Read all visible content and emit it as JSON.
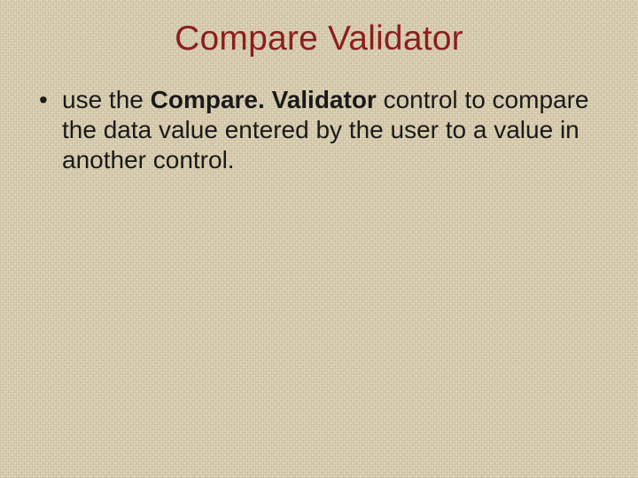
{
  "slide": {
    "title": "Compare Validator",
    "bullets": [
      {
        "prefix": "use the ",
        "bold": "Compare. Validator",
        "suffix": " control to compare the data value entered by the user to a value in another control."
      }
    ]
  },
  "colors": {
    "title": "#8c1e1e",
    "background": "#e1d7bb"
  }
}
